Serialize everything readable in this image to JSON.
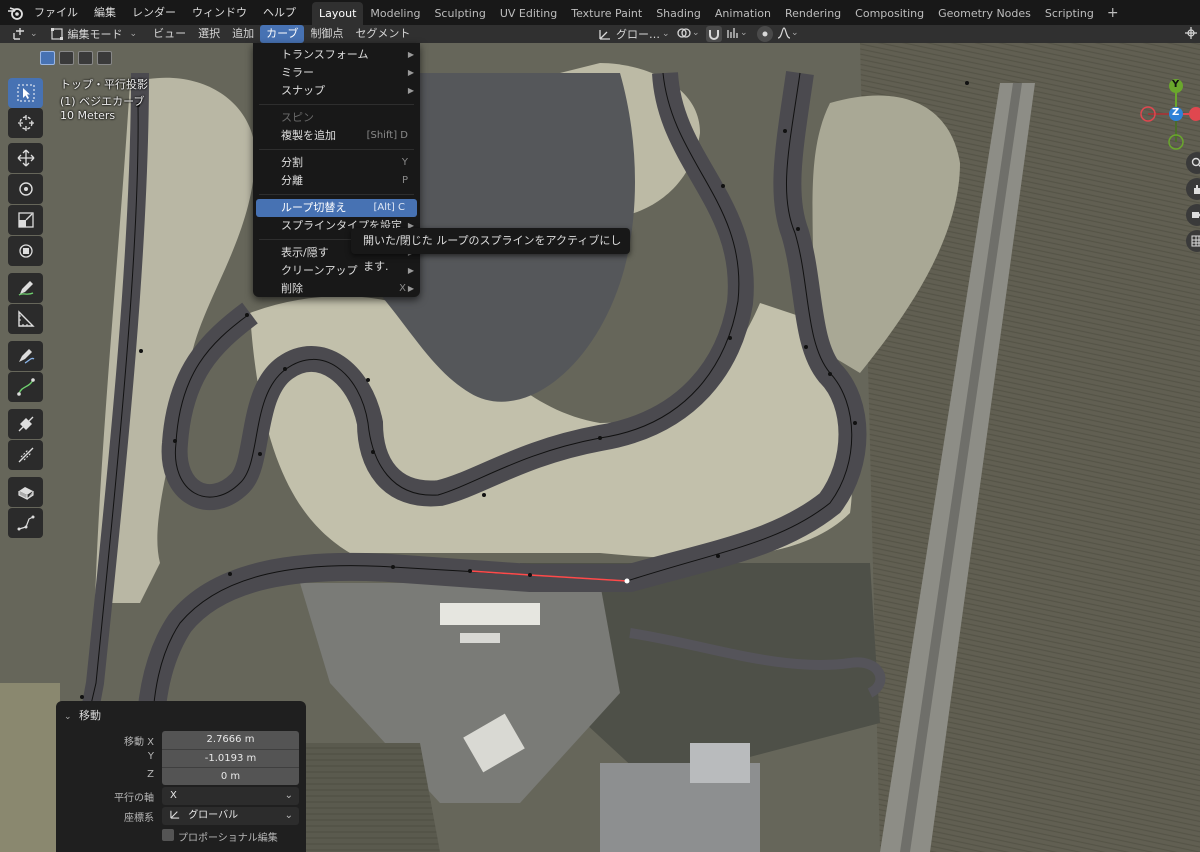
{
  "menubar": {
    "items": [
      "ファイル",
      "編集",
      "レンダー",
      "ウィンドウ",
      "ヘルプ"
    ],
    "workspaces": [
      "Layout",
      "Modeling",
      "Sculpting",
      "UV Editing",
      "Texture Paint",
      "Shading",
      "Animation",
      "Rendering",
      "Compositing",
      "Geometry Nodes",
      "Scripting"
    ],
    "active_workspace": "Layout",
    "add_tab": "+"
  },
  "header": {
    "mode": "編集モード",
    "menus": [
      "ビュー",
      "選択",
      "追加",
      "カーブ",
      "制御点",
      "セグメント"
    ],
    "active_menu": "カーブ",
    "transform_orientation": "グロー…"
  },
  "overlay": {
    "view_name": "トップ・平行投影",
    "object_name": "(1) ベジエカーブ",
    "scale": "10 Meters"
  },
  "dropdown": {
    "items": [
      {
        "label": "トランスフォーム",
        "shortcut": "",
        "submenu": true,
        "state": "normal"
      },
      {
        "label": "ミラー",
        "shortcut": "",
        "submenu": true,
        "state": "normal"
      },
      {
        "label": "スナップ",
        "shortcut": "",
        "submenu": true,
        "state": "normal"
      },
      {
        "sep": true
      },
      {
        "label": "スピン",
        "shortcut": "",
        "submenu": false,
        "state": "disabled"
      },
      {
        "label": "複製を追加",
        "shortcut": "[Shift] D",
        "submenu": false,
        "state": "normal"
      },
      {
        "sep": true
      },
      {
        "label": "分割",
        "shortcut": "Y",
        "submenu": false,
        "state": "normal"
      },
      {
        "label": "分離",
        "shortcut": "P",
        "submenu": false,
        "state": "normal"
      },
      {
        "sep": true
      },
      {
        "label": "ループ切替え",
        "shortcut": "[Alt] C",
        "submenu": false,
        "state": "highlight"
      },
      {
        "label": "スプラインタイプを設定",
        "shortcut": "",
        "submenu": true,
        "state": "normal"
      },
      {
        "sep": true
      },
      {
        "label": "表示/隠す",
        "shortcut": "",
        "submenu": true,
        "state": "normal"
      },
      {
        "label": "クリーンアップ",
        "shortcut": "",
        "submenu": true,
        "state": "normal"
      },
      {
        "label": "削除",
        "shortcut": "X",
        "submenu": true,
        "state": "normal"
      }
    ]
  },
  "tooltip": {
    "text": "開いた/閉じた ループのスプラインをアクティブにします."
  },
  "operator_panel": {
    "title": "移動",
    "fields": [
      {
        "label": "移動 X",
        "value": "2.7666 m"
      },
      {
        "label": "Y",
        "value": "-1.0193 m"
      },
      {
        "label": "Z",
        "value": "0 m"
      }
    ],
    "axis_label": "平行の軸",
    "axis_value": "X",
    "orientation_label": "座標系",
    "orientation_value": "グローバル",
    "proportional_label": "プロポーショナル編集"
  },
  "gizmo": {
    "x_label": "X",
    "y_label": "Y",
    "z_label": "Z",
    "x_color": "#e0474f",
    "y_color": "#6aa72c",
    "z_color": "#2d82d8"
  },
  "colors": {
    "accent": "#4772b3",
    "menu_bg": "#181818",
    "header_bg": "#303030"
  }
}
